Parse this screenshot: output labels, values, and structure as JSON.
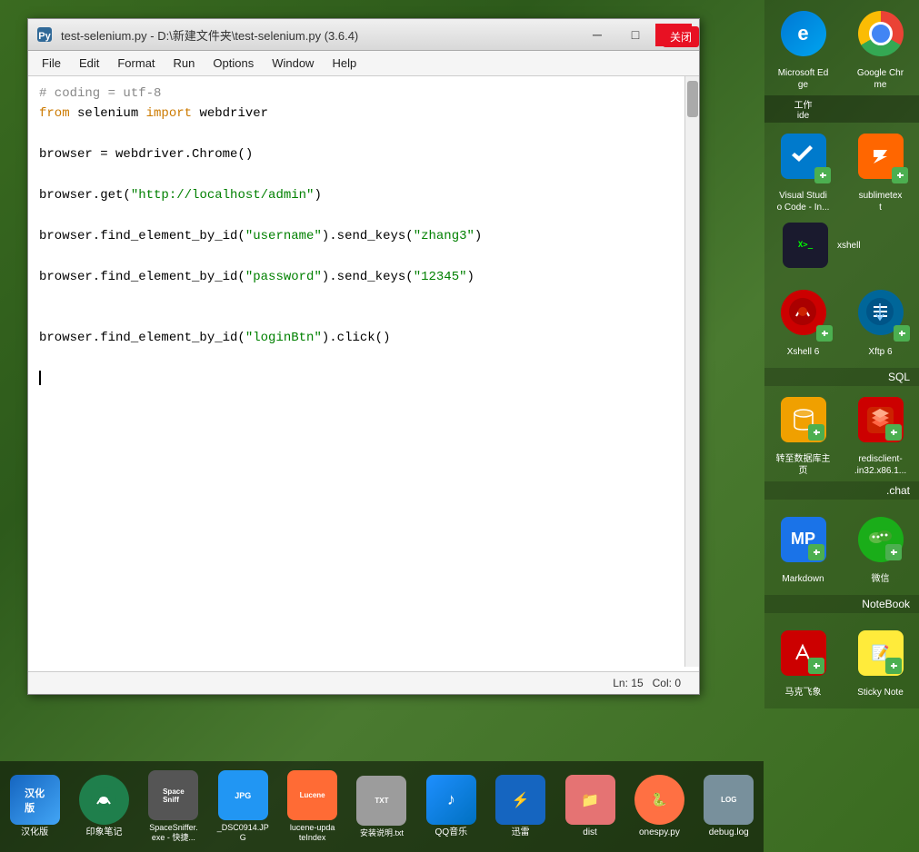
{
  "desktop": {
    "background_color": "#3a6b20"
  },
  "editor_window": {
    "title": "test-selenium.py - D:\\新建文件夹\\test-selenium.py (3.6.4)",
    "title_icon": "python-idle-icon",
    "controls": {
      "minimize_label": "─",
      "maximize_label": "□",
      "close_label": "✕",
      "close_chinese": "关闭"
    },
    "menu": {
      "items": [
        "File",
        "Edit",
        "Format",
        "Run",
        "Options",
        "Window",
        "Help"
      ]
    },
    "code": {
      "lines": [
        {
          "type": "comment",
          "content": "# coding = utf-8"
        },
        {
          "type": "import",
          "content": "from selenium import webdriver"
        },
        {
          "type": "blank",
          "content": ""
        },
        {
          "type": "normal",
          "content": "browser = webdriver.Chrome()"
        },
        {
          "type": "blank",
          "content": ""
        },
        {
          "type": "normal",
          "content": "browser.get(\"http://localhost/admin\")"
        },
        {
          "type": "blank",
          "content": ""
        },
        {
          "type": "normal",
          "content": "browser.find_element_by_id(\"username\").send_keys(\"zhang3\")"
        },
        {
          "type": "blank",
          "content": ""
        },
        {
          "type": "normal",
          "content": "browser.find_element_by_id(\"password\").send_keys(\"12345\")"
        },
        {
          "type": "blank",
          "content": ""
        },
        {
          "type": "blank",
          "content": ""
        },
        {
          "type": "normal",
          "content": "browser.find_element_by_id(\"loginBtn\").click()"
        },
        {
          "type": "blank",
          "content": ""
        },
        {
          "type": "cursor",
          "content": ""
        }
      ]
    },
    "status": {
      "ln": "Ln: 15",
      "col": "Col: 0"
    }
  },
  "sidebar_right": {
    "sections": [
      {
        "type": "pair",
        "left": {
          "icon": "ie-icon",
          "label": "Microsoft Ed\nge"
        },
        "right": {
          "icon": "chrome-icon",
          "label": "Google Chr\nme"
        }
      },
      {
        "type": "pair",
        "left": {
          "icon": "vscode-icon",
          "label": "Visual Studi\no Code - In..."
        },
        "right": {
          "icon": "sublime-icon",
          "label": "sublimetex\nt"
        }
      },
      {
        "type": "single",
        "icon": "xshell-icon",
        "label": "xshell"
      },
      {
        "type": "pair",
        "left": {
          "icon": "xshell6-icon",
          "label": "Xshell 6"
        },
        "right": {
          "icon": "xftp6-icon",
          "label": "Xftp 6"
        }
      },
      {
        "type": "single",
        "icon": "sql-icon",
        "label": "SQL"
      },
      {
        "type": "pair",
        "left": {
          "icon": "sql-db-icon",
          "label": "转至数据库主\n页"
        },
        "right": {
          "icon": "redis-icon",
          "label": "redisclient-\n.in32.x86.1..."
        }
      },
      {
        "type": "single",
        "icon": "chat-icon",
        "label": ".chat"
      },
      {
        "type": "pair",
        "left": {
          "icon": "mp-icon",
          "label": "Markdown"
        },
        "right": {
          "icon": "wechat-icon",
          "label": "微信"
        }
      },
      {
        "type": "single",
        "icon": "notebook-icon",
        "label": "NoteBook"
      },
      {
        "type": "pair",
        "left": {
          "icon": "makefei-icon",
          "label": "马克飞象"
        },
        "right": {
          "icon": "sticky-icon",
          "label": "Sticky Note"
        }
      }
    ]
  },
  "taskbar_bottom": {
    "items": [
      {
        "icon": "hanzify-icon",
        "label": "汉化版"
      },
      {
        "icon": "yinxiang-icon",
        "label": "印象笔记"
      },
      {
        "icon": "spacesniffer-icon",
        "label": "SpaceSniffer.\nexe - 快捷..."
      },
      {
        "icon": "dsc-icon",
        "label": "_DSC0914.JP\nG"
      },
      {
        "icon": "lucene-icon",
        "label": "lucene-upda\nteIndex"
      },
      {
        "icon": "install-icon",
        "label": "安装说明.txt"
      },
      {
        "icon": "qqmusic-icon",
        "label": "QQ音乐"
      },
      {
        "icon": "thunder-icon",
        "label": "迅雷"
      },
      {
        "icon": "dist-icon",
        "label": "dist"
      },
      {
        "icon": "onespy-icon",
        "label": "onespy.py"
      },
      {
        "icon": "debuglog-icon",
        "label": "debug.log"
      }
    ]
  }
}
